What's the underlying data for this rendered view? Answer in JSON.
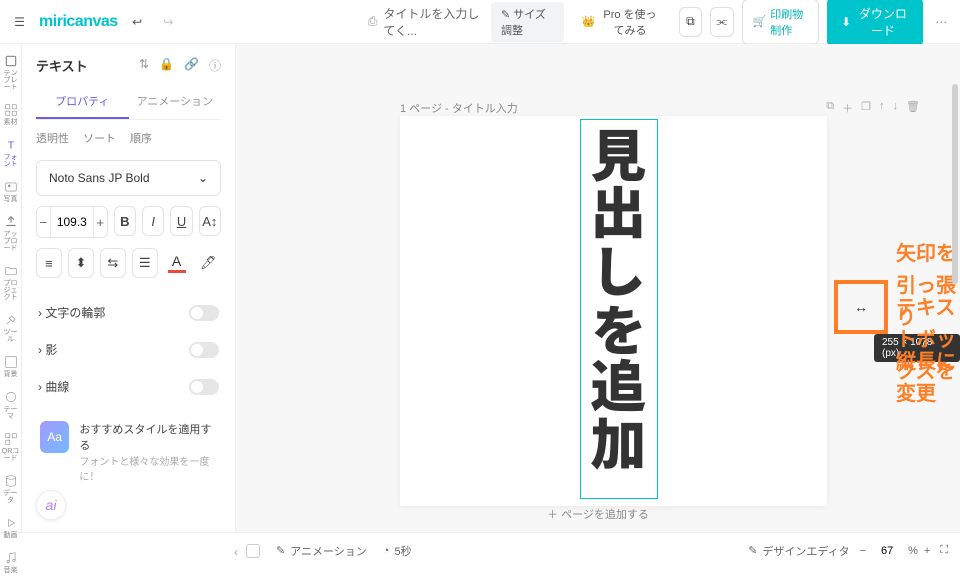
{
  "app": {
    "logo_pre": "miri",
    "logo_post": "canvas"
  },
  "top": {
    "title_label": "タイトルを入力してく...",
    "size_btn": "サイズ調整",
    "pro": "Pro を使ってみる",
    "print": "印刷物制作",
    "download": "ダウンロード"
  },
  "rail": [
    {
      "label": "テンプレート",
      "icon": "template"
    },
    {
      "label": "素材",
      "icon": "grid"
    },
    {
      "label": "フォント",
      "icon": "text",
      "active": true
    },
    {
      "label": "写真",
      "icon": "image"
    },
    {
      "label": "アップロード",
      "icon": "upload"
    },
    {
      "label": "プロジェクト",
      "icon": "folder"
    },
    {
      "label": "ツール",
      "icon": "wand"
    },
    {
      "label": "背景",
      "icon": "bg"
    },
    {
      "label": "テーマ",
      "icon": "theme"
    },
    {
      "label": "QRコード",
      "icon": "qr"
    },
    {
      "label": "データ",
      "icon": "data"
    },
    {
      "label": "動画",
      "icon": "video"
    },
    {
      "label": "音楽",
      "icon": "music"
    }
  ],
  "panel": {
    "title": "テキスト",
    "tab_prop": "プロパティ",
    "tab_anim": "アニメーション",
    "sub": [
      "透明性",
      "ソート",
      "順序"
    ],
    "font": "Noto Sans JP Bold",
    "size": "109.3",
    "acc": [
      "文字の輪郭",
      "影",
      "曲線"
    ],
    "rec_title": "おすすめスタイルを適用する",
    "rec_sub": "フォントと様々な効果を一度に！",
    "rec_badge": "Aa",
    "ai": "ai"
  },
  "canvas": {
    "page_head": "1 ページ - タイトル入力",
    "text": "見出しを追加",
    "size_tip": "255 × 1078 (px)",
    "annot1": "矢印を引っ張り",
    "annot2": "テキストボックスを",
    "annot3": "縦長に変更",
    "add_page": "＋ ページを追加する"
  },
  "bottom": {
    "anim": "アニメーション",
    "duration": "5秒",
    "editor": "デザインエディタ",
    "zoom": "67",
    "pct": "%"
  }
}
